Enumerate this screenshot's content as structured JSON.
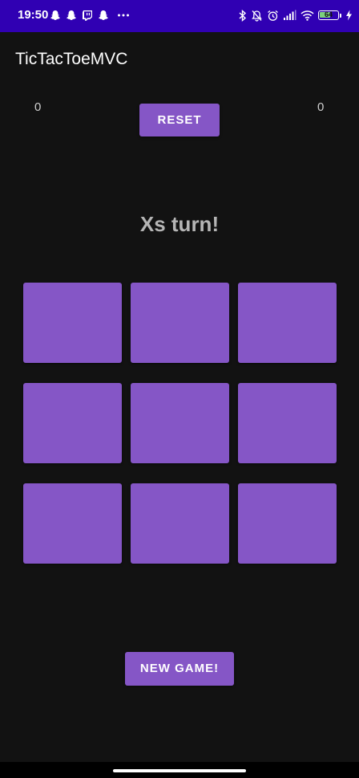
{
  "status_bar": {
    "time": "19:50",
    "left_icons": [
      "snapchat-icon",
      "snapchat-icon",
      "twitch-icon",
      "snapchat-icon",
      "more-dots-icon"
    ],
    "right_icons": [
      "bluetooth-icon",
      "muted-bell-icon",
      "alarm-icon",
      "signal-icon",
      "wifi-icon",
      "battery-icon",
      "charging-bolt-icon"
    ],
    "battery_level": "64",
    "colors": {
      "background": "#3000b3",
      "battery_fill": "#7cd17c"
    }
  },
  "app_bar": {
    "title": "TicTacToeMVC"
  },
  "scores": {
    "x": "0",
    "o": "0"
  },
  "buttons": {
    "reset": "RESET",
    "new_game": "NEW GAME!"
  },
  "turn_text": "Xs turn!",
  "board": {
    "cells": [
      "",
      "",
      "",
      "",
      "",
      "",
      "",
      "",
      ""
    ]
  },
  "colors": {
    "accent": "#8556c6",
    "background": "#121212",
    "turn_text": "#b5b5b5"
  }
}
